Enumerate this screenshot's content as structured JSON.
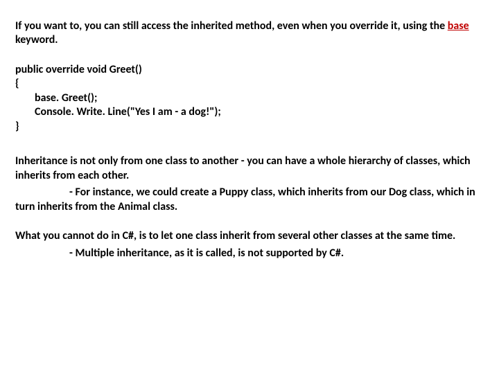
{
  "p1_a": "If you want to, you can still access the inherited method, even when you override it, using the ",
  "p1_b": "base",
  "p1_c": " keyword.",
  "code": {
    "l1": "public override void Greet()",
    "l2": "{",
    "l3": "base. Greet();",
    "l4": "Console. Write. Line(\"Yes I am - a dog!\");",
    "l5": "}"
  },
  "p2": "Inheritance is not only from one class to another - you can have a whole hierarchy of classes, which inherits from each other.",
  "p2_sub": "For instance, we could create a Puppy class, which inherits from our Dog class, which in turn inherits from the Animal class.",
  "p3": "What you cannot do in C#, is to let one class inherit from several other classes at the same time.",
  "p3_sub": "Multiple inheritance, as it is called, is not supported by C#."
}
